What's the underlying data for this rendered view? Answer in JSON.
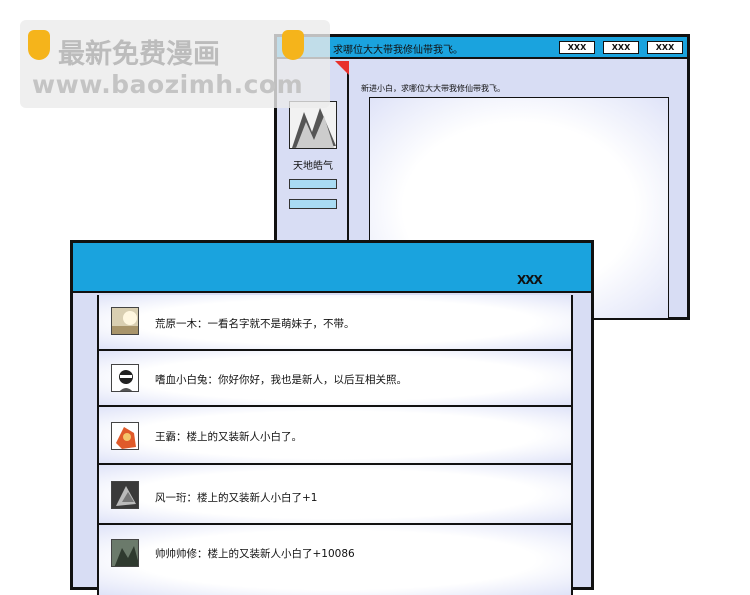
{
  "back_window": {
    "title": "求哪位大大带我修仙带我飞。",
    "buttons": [
      "XXX",
      "XXX",
      "XXX"
    ],
    "username": "天地皓气",
    "subtitle": "新进小白，求哪位大大带我修仙带我飞。"
  },
  "front_window": {
    "close_label": "XXX",
    "posts": [
      {
        "text": "荒原一木：一看名字就不是萌妹子，不带。"
      },
      {
        "text": "嗜血小白兔：你好你好，我也是新人，以后互相关照。"
      },
      {
        "text": "王霸：楼上的又装新人小白了。"
      },
      {
        "text": "风一珩：楼上的又装新人小白了+1"
      },
      {
        "text": "帅帅帅修：楼上的又装新人小白了+10086"
      }
    ]
  },
  "watermark": {
    "line1": "最新免费漫画",
    "line2": "www.baozimh.com"
  },
  "colors": {
    "titlebar": "#1aa3de",
    "panel": "#d8ddf4",
    "accent_red": "#e8312c"
  }
}
